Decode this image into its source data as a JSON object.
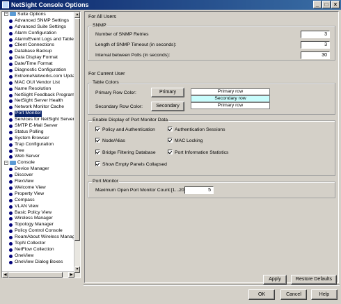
{
  "window": {
    "title": "NetSight Console Options",
    "controls": [
      "_",
      "□",
      "×"
    ]
  },
  "tree": {
    "groups": [
      {
        "label": "Suite Options",
        "items": [
          "Advanced SNMP Settings",
          "Advanced Suite Settings",
          "Alarm Configuration",
          "Alarm/Event Logs and Tables",
          "Client Connections",
          "Database Backup",
          "Data Display Format",
          "Date/Time Format",
          "Diagnostic Configuration",
          "ExtremeNetworks.com Update",
          "MAC OUI Vendor List",
          "Name Resolution",
          "NetSight Feedback Program",
          "NetSight Server Health",
          "Network Monitor Cache",
          "Port Monitor",
          "Services for NetSight Server",
          "SMTP E-Mail Server",
          "Status Polling",
          "System Browser",
          "Trap Configuration",
          "Tree",
          "Web Server"
        ]
      },
      {
        "label": "Console",
        "items": [
          "Device Manager",
          "Discover",
          "FlexView",
          "Welcome View",
          "Property View",
          "Compass",
          "VLAN View",
          "Basic Policy View",
          "Wireless Manager",
          "Topology Manager",
          "Policy Control Console",
          "RoamAbout Wireless Manager",
          "TopN Collector",
          "NetFlow Collection",
          "OneView",
          "OneView Dialog Boxes"
        ]
      }
    ],
    "selected": "Port Monitor"
  },
  "all_users": {
    "heading": "For All Users",
    "snmp": {
      "title": "SNMP",
      "retries_label": "Number of SNMP Retries",
      "retries_value": "3",
      "timeout_label": "Length of SNMP Timeout (in seconds):",
      "timeout_value": "3",
      "interval_label": "Interval between Polls (in seconds):",
      "interval_value": "30"
    }
  },
  "current_user": {
    "heading": "For Current User",
    "table_colors": {
      "title": "Table Colors",
      "primary_label": "Primary Row Color:",
      "primary_button": "Primary",
      "secondary_label": "Secondary Row Color:",
      "secondary_button": "Secondary",
      "preview_rows": [
        "Primary row",
        "Secondary row",
        "Primary row"
      ],
      "primary_color": "#ffffff",
      "secondary_color": "#c8fcfc"
    },
    "port_monitor_data": {
      "title": "Enable Display of Port Monitor Data",
      "options": [
        "Policy and Authentication",
        "Authentication Sessions",
        "Node/Alias",
        "MAC Locking",
        "Bridge Filtering Database",
        "Port Information Statistics",
        "Show Empty Panels Collapsed"
      ]
    },
    "port_monitor": {
      "title": "Port Monitor",
      "max_label": "Maximum Open Port Monitor Count:[1...20]",
      "max_value": "5"
    }
  },
  "actions": {
    "apply": "Apply",
    "restore": "Restore Defaults",
    "ok": "OK",
    "cancel": "Cancel",
    "help": "Help"
  }
}
